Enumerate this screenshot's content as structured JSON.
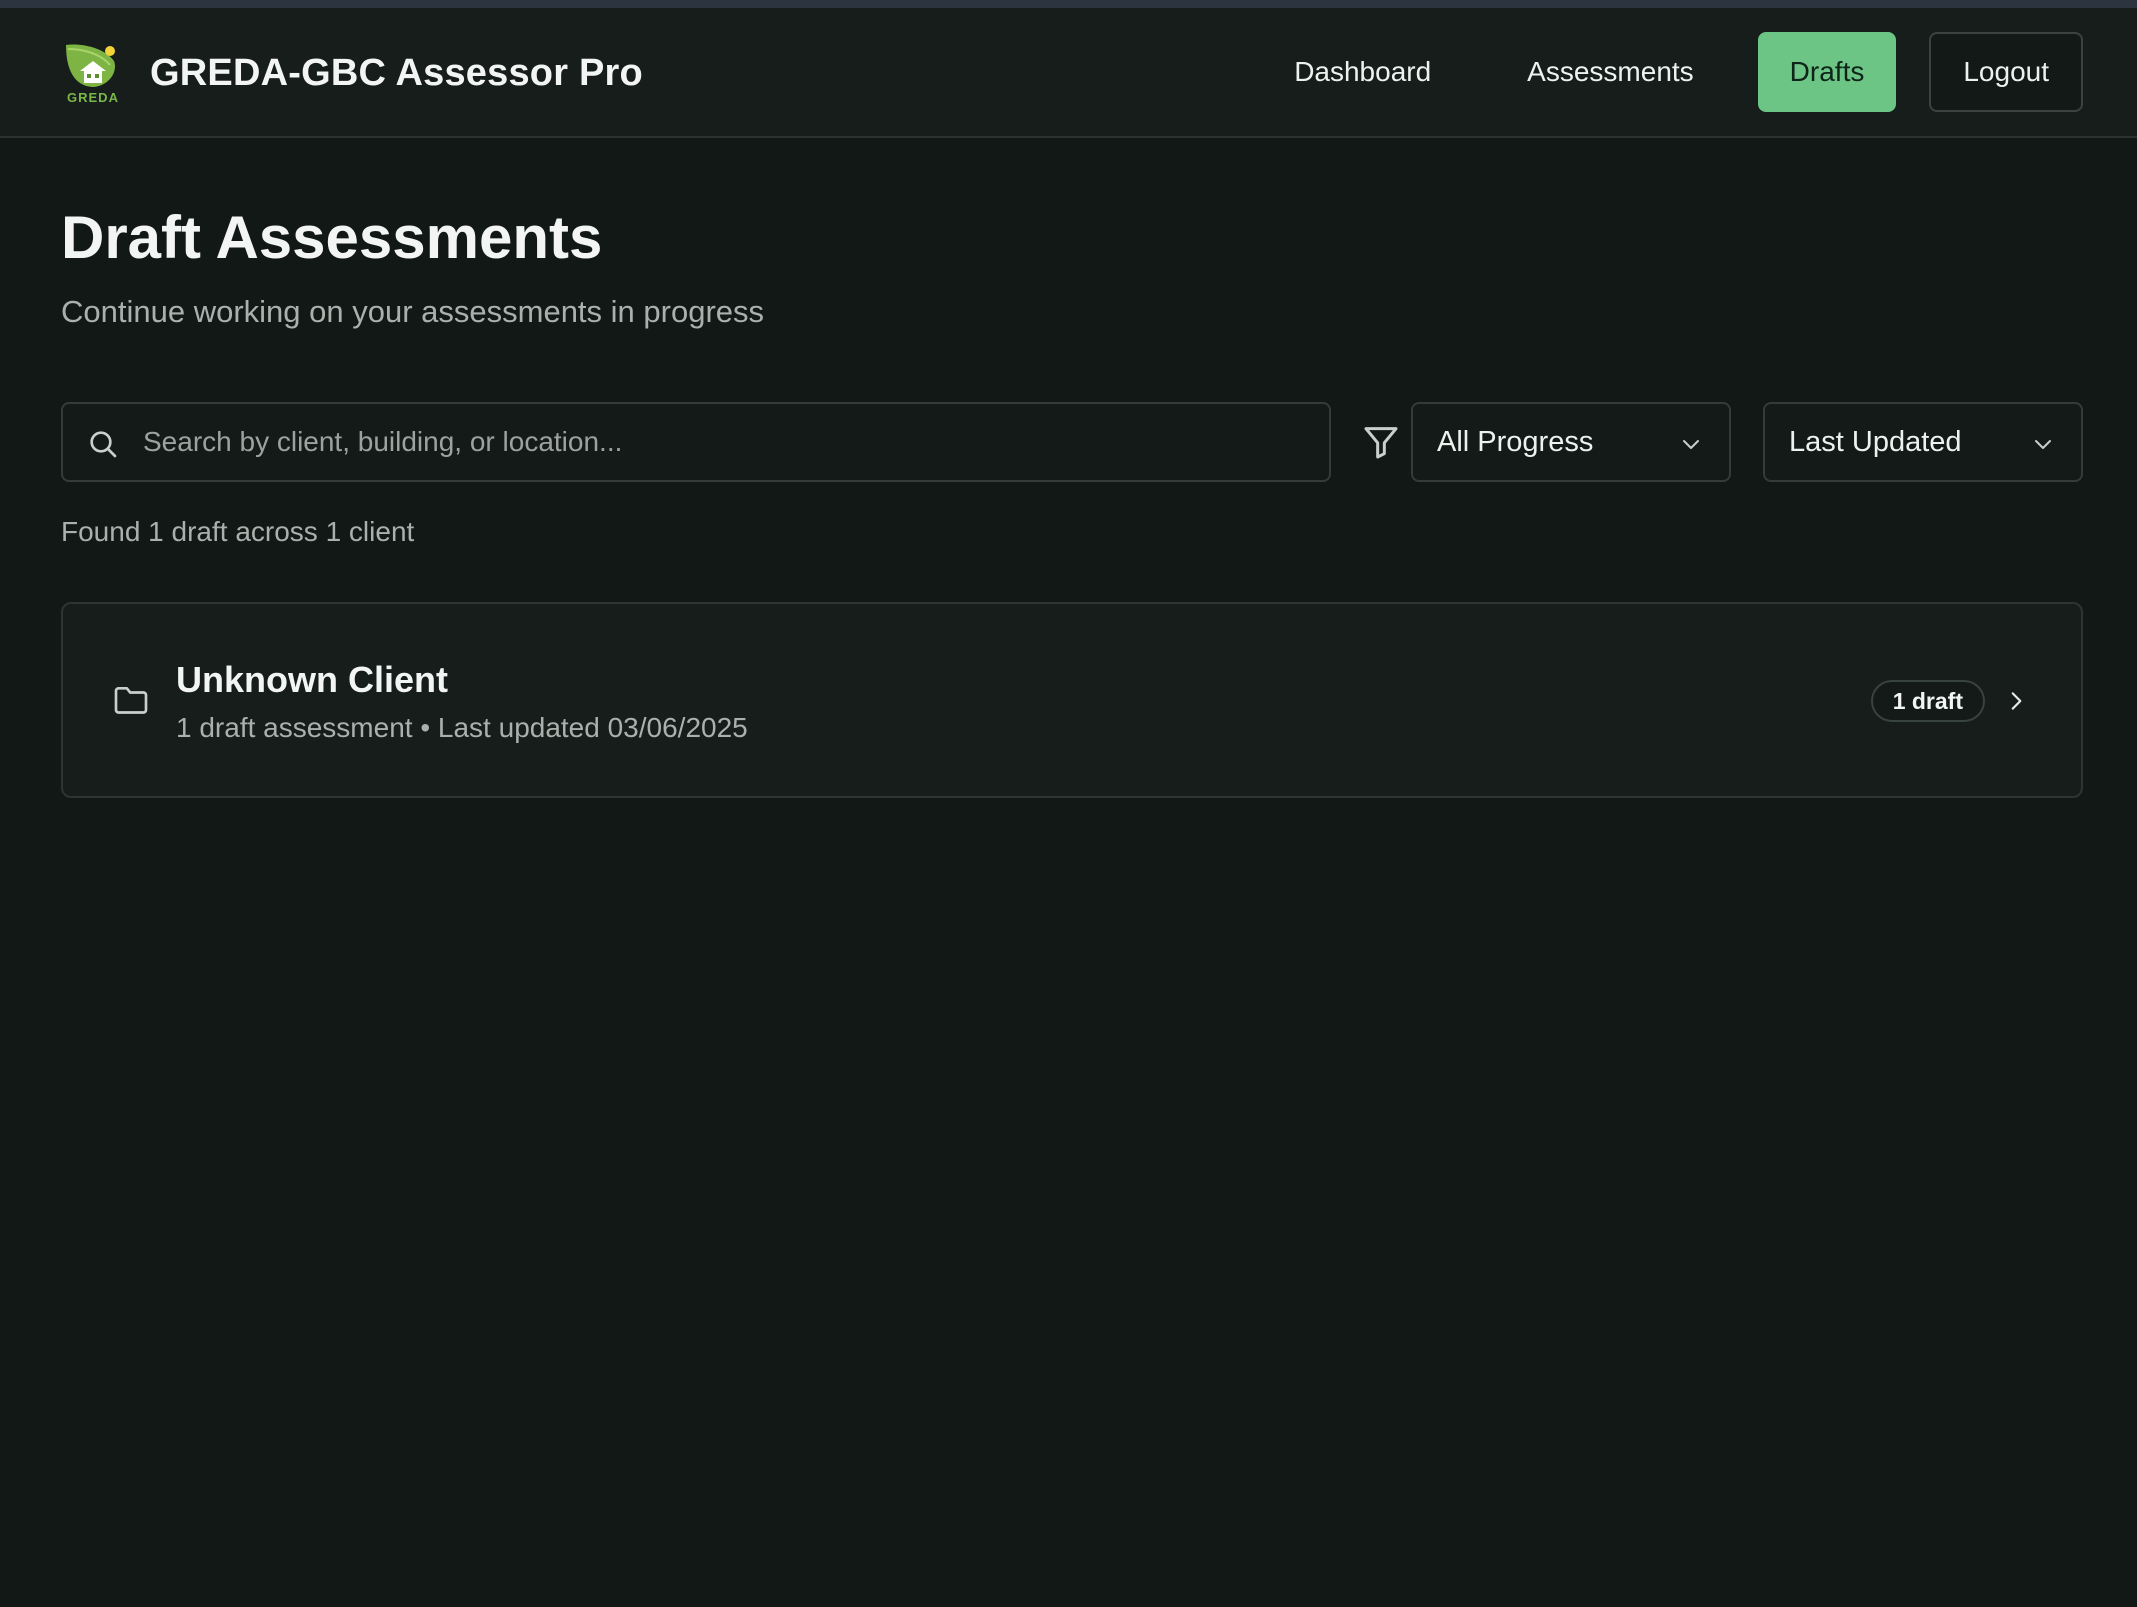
{
  "app": {
    "title": "GREDA-GBC Assessor Pro",
    "logo_text": "GREDA"
  },
  "nav": {
    "items": [
      {
        "label": "Dashboard",
        "active": false
      },
      {
        "label": "Assessments",
        "active": false
      },
      {
        "label": "Drafts",
        "active": true
      }
    ],
    "logout_label": "Logout"
  },
  "page": {
    "title": "Draft Assessments",
    "subtitle": "Continue working on your assessments in progress"
  },
  "search": {
    "placeholder": "Search by client, building, or location...",
    "value": ""
  },
  "filters": {
    "progress_selected": "All Progress",
    "sort_selected": "Last Updated"
  },
  "results": {
    "summary": "Found 1 draft across 1 client"
  },
  "groups": [
    {
      "client_name": "Unknown Client",
      "meta": "1 draft assessment • Last updated 03/06/2025",
      "badge": "1 draft"
    }
  ],
  "colors": {
    "background": "#121816",
    "navbar": "#161d1b",
    "accent": "#6cc585",
    "border": "#343c39",
    "muted_text": "#a9b1ad"
  }
}
